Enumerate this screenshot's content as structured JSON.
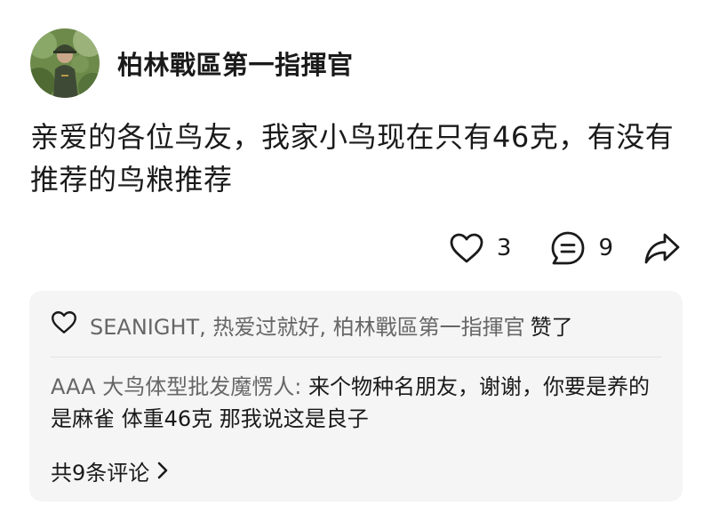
{
  "post": {
    "author_name": "柏林戰區第一指揮官",
    "avatar_icon": "avatar-soldier-photo",
    "text": "亲爱的各位鸟友，我家小鸟现在只有46克，有没有推荐的鸟粮推荐"
  },
  "actions": {
    "like_icon": "heart-outline-icon",
    "like_count": "3",
    "comment_icon": "comment-bubble-icon",
    "comment_count": "9",
    "share_icon": "share-arrow-icon"
  },
  "comments_panel": {
    "likes_icon": "heart-outline-icon",
    "likers": "SEANIGHT, 热爱过就好, 柏林戰區第一指揮官",
    "likes_suffix": "赞了",
    "top_comment": {
      "author": "AAA 大鸟体型批发魔愣人:",
      "text": "来个物种名朋友，谢谢，你要是养的是麻雀 体重46克 那我说这是良子"
    },
    "view_all_label": "共9条评论",
    "view_all_icon": "chevron-right-icon"
  },
  "colors": {
    "primary_text": "#1a1a1a",
    "secondary_text": "#666666",
    "panel_background": "#f5f5f5"
  }
}
